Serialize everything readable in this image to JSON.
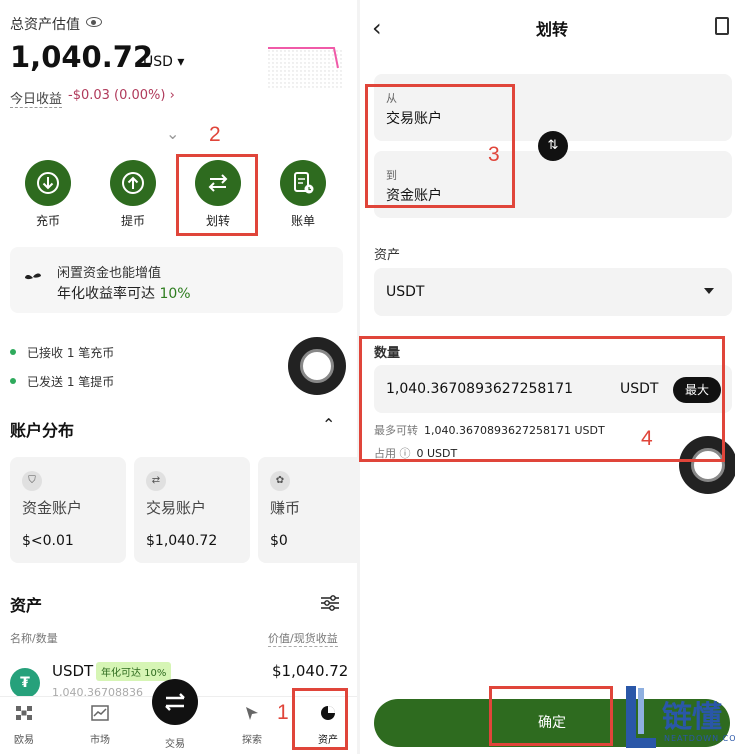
{
  "assets_screen": {
    "estimated_label": "总资产估值",
    "total_value": "1,040.72",
    "currency": "USD ▾",
    "today_label": "今日收益",
    "today_value": "-$0.03 (0.00%) ›",
    "actions": [
      {
        "label": "充币",
        "icon": "deposit-icon"
      },
      {
        "label": "提币",
        "icon": "withdraw-icon"
      },
      {
        "label": "划转",
        "icon": "transfer-icon"
      },
      {
        "label": "账单",
        "icon": "bill-icon"
      }
    ],
    "promo": {
      "line1": "闲置资金也能增值",
      "line2_prefix": "年化收益率可达",
      "line2_highlight": "10%"
    },
    "notices": [
      "已接收 1 笔充币",
      "已发送 1 笔提币"
    ],
    "account_dist_title": "账户分布",
    "accounts": [
      {
        "name": "资金账户",
        "value": "$<0.01"
      },
      {
        "name": "交易账户",
        "value": "$1,040.72"
      },
      {
        "name": "赚币",
        "value": "$0"
      }
    ],
    "assets_title": "资产",
    "col_left": "名称/数量",
    "col_right": "价值/现货收益",
    "usdt": {
      "name": "USDT",
      "tag": "年化可达 10%",
      "value": "$1,040.72",
      "amount": "1,040.36708836"
    },
    "nav": [
      {
        "label": "欧易",
        "icon": "home-icon"
      },
      {
        "label": "市场",
        "icon": "market-icon"
      },
      {
        "label": "交易",
        "icon": "trade-icon"
      },
      {
        "label": "探索",
        "icon": "explore-icon"
      },
      {
        "label": "资产",
        "icon": "assets-icon"
      }
    ]
  },
  "transfer_screen": {
    "title": "划转",
    "from_label": "从",
    "from_value": "交易账户",
    "to_label": "到",
    "to_value": "资金账户",
    "asset_label": "资产",
    "asset_value": "USDT",
    "amount_label": "数量",
    "amount_value": "1,040.3670893627258171",
    "amount_unit": "USDT",
    "max_label": "最大",
    "max_transfer_label": "最多可转",
    "max_transfer_value": "1,040.3670893627258171 USDT",
    "occupied_label": "占用 ⓘ",
    "occupied_value": "0 USDT",
    "confirm_label": "确定"
  },
  "annotations": [
    "1",
    "2",
    "3",
    "4"
  ],
  "watermark": {
    "text": "链懂",
    "sub": "NEATDOWN.COM"
  },
  "colors": {
    "accent": "#2e6b1f",
    "annotation": "#e0453a",
    "negative": "#b03a5b"
  }
}
